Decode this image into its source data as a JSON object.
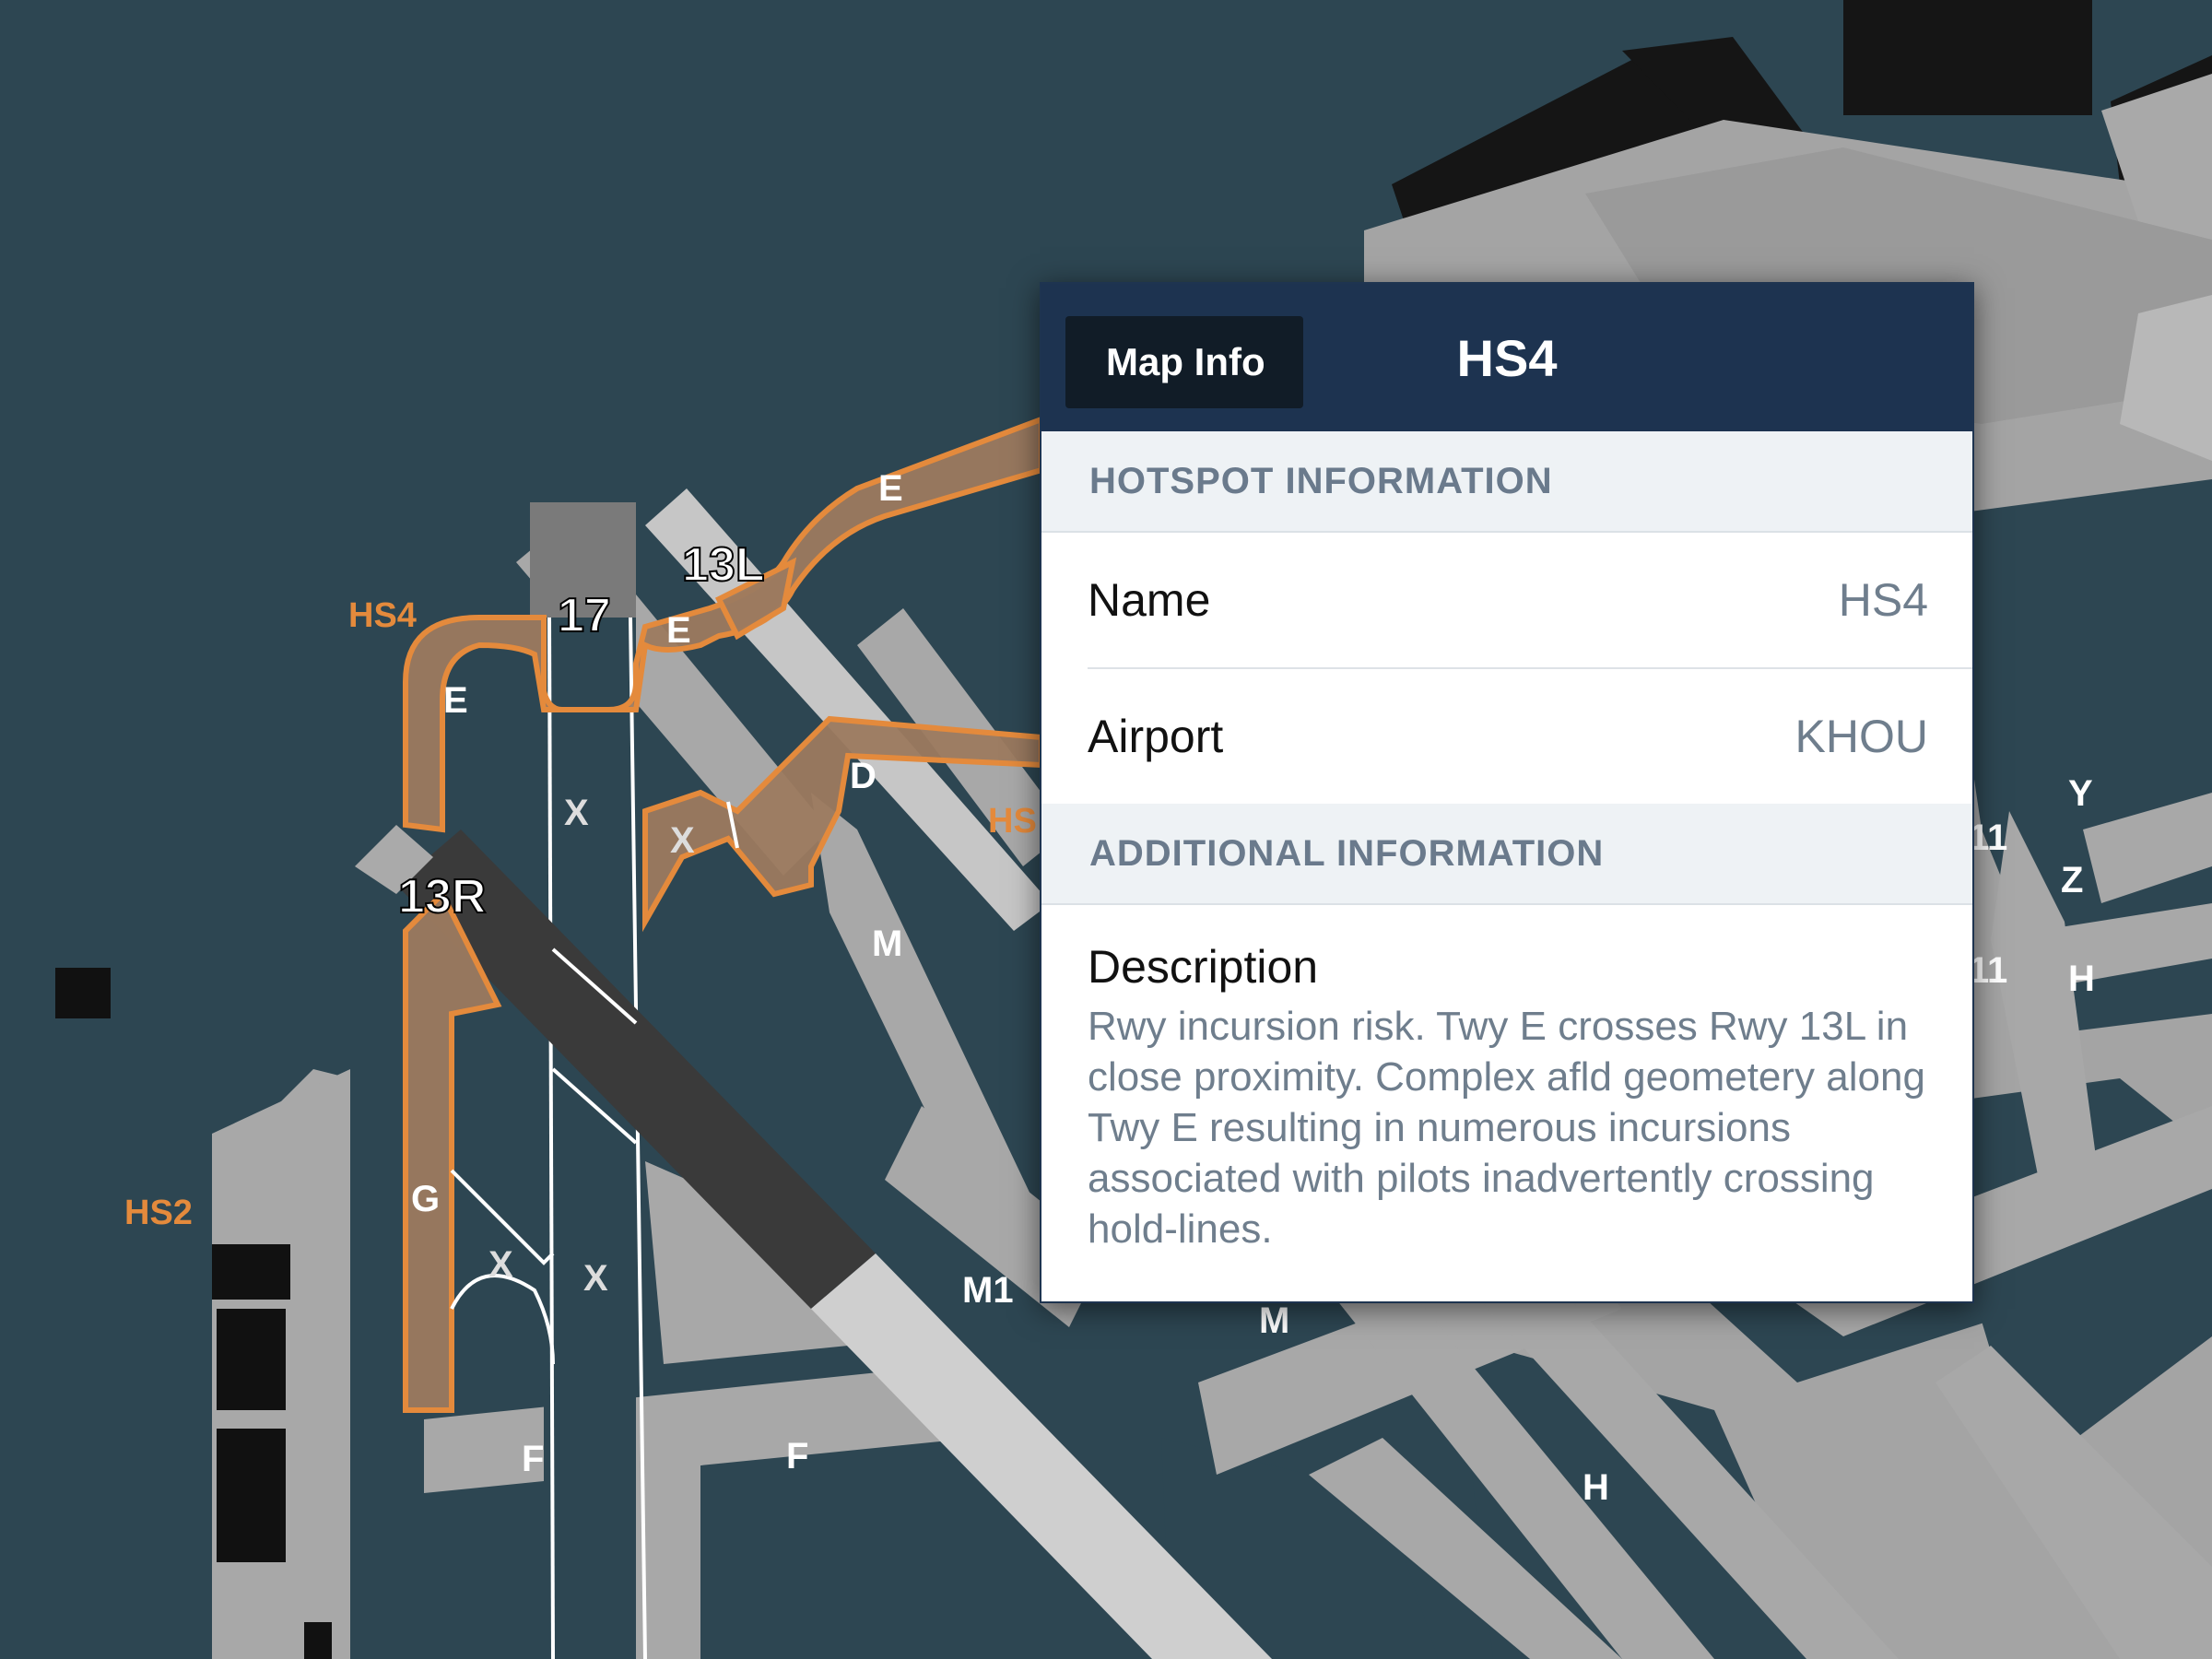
{
  "map": {
    "labels": {
      "hs4": "HS4",
      "hs2": "HS2",
      "hs_partial": "HS",
      "rwy_13l": "13L",
      "rwy_13r": "13R",
      "rwy_17": "17",
      "twy_e1": "E",
      "twy_e2": "E",
      "twy_e3": "E",
      "twy_d": "D",
      "twy_x1": "X",
      "twy_x2": "X",
      "twy_x3": "X",
      "twy_x4": "X",
      "twy_m1": "M",
      "twy_m2": "M",
      "twy_m1b": "M1",
      "twy_g": "G",
      "twy_f1": "F",
      "twy_f2": "F",
      "twy_h1": "H",
      "twy_h2": "H",
      "twy_y": "Y",
      "twy_z": "Z",
      "twy_11a": "11",
      "twy_11b": "11"
    },
    "colors": {
      "background": "#2d4652",
      "apron": "#a9a9a9",
      "runway": "#3a3a3a",
      "hotspot": "#e48a3c"
    }
  },
  "popup": {
    "back_label": "Map Info",
    "title": "HS4",
    "section1": "HOTSPOT INFORMATION",
    "rows": [
      {
        "key": "Name",
        "value": "HS4"
      },
      {
        "key": "Airport",
        "value": "KHOU"
      }
    ],
    "section2": "ADDITIONAL INFORMATION",
    "description_heading": "Description",
    "description_text": "Rwy incursion risk. Twy E crosses Rwy 13L in close proximity. Complex afld geometery along Twy E resulting in numerous incursions associated with pilots inadvertently crossing hold-lines."
  }
}
